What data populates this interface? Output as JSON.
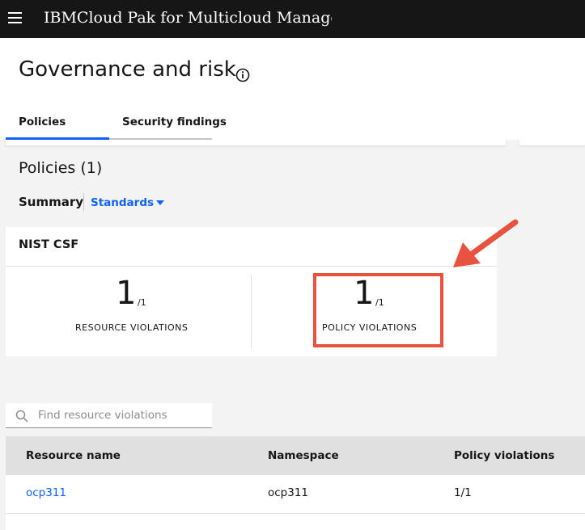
{
  "header": {
    "app_title": "IBMCloud Pak for Multicloud Manager",
    "menu_icon": "hamburger-menu-icon"
  },
  "page": {
    "title": "Governance and risk",
    "info_icon": "info-icon"
  },
  "tabs": [
    {
      "label": "Policies",
      "active": true
    },
    {
      "label": "Security findings",
      "active": false
    }
  ],
  "policies": {
    "section_title": "Policies (1)",
    "summary_label": "Summary",
    "standards_dropdown": "Standards",
    "card": {
      "title": "NIST CSF",
      "resource_violations": {
        "value": "1",
        "total": "/1",
        "label": "RESOURCE VIOLATIONS"
      },
      "policy_violations": {
        "value": "1",
        "total": "/1",
        "label": "POLICY VIOLATIONS"
      }
    }
  },
  "search": {
    "placeholder": "Find resource violations",
    "value": ""
  },
  "table": {
    "columns": [
      "Resource name",
      "Namespace",
      "Policy violations"
    ],
    "rows": [
      {
        "resource_name": "ocp311",
        "namespace": "ocp311",
        "policy_violations": "1/1"
      }
    ]
  },
  "colors": {
    "accent": "#0f62fe",
    "header_bg": "#161616",
    "highlight": "#e8533f"
  }
}
